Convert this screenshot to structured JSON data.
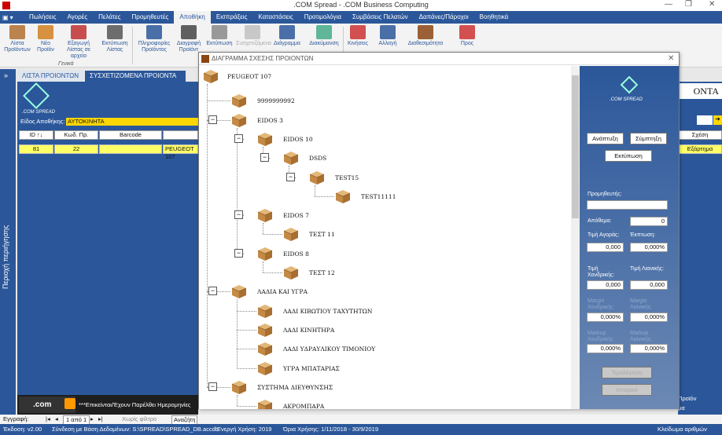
{
  "window": {
    "title": ".COM Spread - .COM Business Computing",
    "min": "—",
    "restore": "❐",
    "close": "✕"
  },
  "menu": [
    "Πωλήσεις",
    "Αγορές",
    "Πελάτες",
    "Προμηθευτές",
    "Αποθήκη",
    "Εισπράξεις",
    "Καταστάσεις",
    "Προτιμολόγια",
    "Συμβάσεις Πελατών",
    "Δαπάνες/Πάροχοι",
    "Βοηθητικά"
  ],
  "menu_active": 4,
  "ribbon": {
    "buttons": [
      "Λίστα Προϊόντων",
      "Νέο Προϊόν",
      "Εξαγωγή Λίστας σε αρχείο",
      "Εκτύπωση Λίστας",
      "Πληροφορίες Προϊόντος",
      "Διαγραφή Προϊόντ",
      "Εκτύπωση",
      "Συσχετιζόμενα",
      "Διάγραμμα",
      "Διακύμανση",
      "Κινήσεις",
      "Αλλαγή",
      "Διαθεσιμότητα",
      "Προς"
    ],
    "group": "Γενικά"
  },
  "tabs": {
    "list": "ΛΙΣΤΑ ΠΡΟΙΟΝΤΩΝ",
    "related": "ΣΥΣΧΕΤΙΖΟΜΕΝΑ ΠΡΟΙΟΝΤΑ"
  },
  "left_panel_label": "Περιοχή περιήγησης",
  "brand": ".COM SPREAD",
  "warehouse": {
    "label": "Είδος Αποθήκης:",
    "value": "ΑΥΤΟΚΙΝΗΤΑ"
  },
  "table": {
    "headers": [
      "ID ↑↓",
      "Κωδ. Πρ.",
      "Barcode",
      ""
    ],
    "row": [
      "81",
      "22",
      "",
      "PEUGEOT 107"
    ]
  },
  "right_bg": {
    "title": "ΟΝΤΑ",
    "relation_label": "Σχέση",
    "relation_value": "Εξάρτημα",
    "bottom1": "Προϊόν",
    "bottom2": "μα"
  },
  "bottom_notice": "***Επικείνται/Έχουν Παρέλθει Ημερομηνίες",
  "footer": {
    "records": "Εγγραφή:",
    "nav": "1 από 1",
    "filter": "Χωρίς φίλτρο",
    "search": "Αναζήτη"
  },
  "statusbar": {
    "version": "Έκδοση: v2.00",
    "db": "Σύνδεση με Βάση Δεδομένων: S:\\SPREAD\\SPREAD_DB.accdb",
    "year": "Ενεργή Χρήση: 2019",
    "limits": "Όρια Χρήσης: 1/11/2018 - 30/9/2019",
    "numlock": "Κλείδωμα αριθμών"
  },
  "dialog": {
    "title": "ΔΙΑΓΡΑΜΜΑ ΣΧΕΣΗΣ ΠΡΟΙΟΝΤΩΝ",
    "tree": [
      "PEUGEOT 107",
      "9999999992",
      "EIDOS 3",
      "EIDOS 10",
      "DSDS",
      "TEST15",
      "TEST11111",
      "EIDOS 7",
      "ΤΕΣΤ 11",
      "EIDOS 8",
      "ΤΕΣΤ 12",
      "ΛΑΔΙΑ ΚΑΙ ΥΓΡΑ",
      "ΛΑΔΙ ΚΙΒΩΤΙΟΥ ΤΑΧΥΤΗΤΩΝ",
      "ΛΑΔΙ ΚΙΝΗΤΗΡΑ",
      "ΛΑΔΙ ΥΔΡΑΥΛΙΚΟΥ ΤΙΜΟΝΙΟΥ",
      "ΥΓΡΑ ΜΠΑΤΑΡΙΑΣ",
      "ΣΥΣΤΗΜΑ ΔΙΕΥΘΥΝΣΗΣ",
      "ΑΚΡΟΜΠΑΡΑ"
    ],
    "side": {
      "expand": "Ανάπτυξη",
      "collapse": "Σύμπτηξη",
      "print": "Εκτύπωση",
      "supplier": "Προμηθευτής:",
      "stock": "Απόθεμα:",
      "stock_val": "0",
      "buy_price": "Τιμή Αγοράς:",
      "discount": "Έκπτωση:",
      "buy_val": "0,000",
      "disc_val": "0,000%",
      "wholesale": "Τιμή Χονδρικής:",
      "retail": "Τιμή Λιανικής:",
      "wh_val": "0,000",
      "rt_val": "0,000",
      "margin_wh": "Margin Χονδρικής:",
      "margin_rt": "Margin Λιανικής:",
      "mw_val": "0,000%",
      "mr_val": "0,000%",
      "markup_wh": "Markup Χονδρικής:",
      "markup_rt": "Markup Λιανικής:",
      "kw_val": "0,000%",
      "kr_val": "0,000%",
      "btn1": "Τιμολόγηση",
      "btn2": "Ιστορικό"
    }
  },
  "colors": {
    "accent": "#2b579a",
    "highlight": "#ffff66",
    "category": "#ffd700"
  }
}
